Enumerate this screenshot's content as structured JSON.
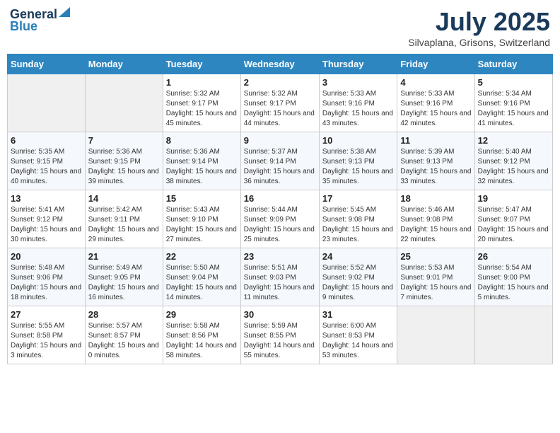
{
  "logo": {
    "general": "General",
    "blue": "Blue"
  },
  "title": "July 2025",
  "location": "Silvaplana, Grisons, Switzerland",
  "headers": [
    "Sunday",
    "Monday",
    "Tuesday",
    "Wednesday",
    "Thursday",
    "Friday",
    "Saturday"
  ],
  "weeks": [
    [
      {
        "day": "",
        "sunrise": "",
        "sunset": "",
        "daylight": ""
      },
      {
        "day": "",
        "sunrise": "",
        "sunset": "",
        "daylight": ""
      },
      {
        "day": "1",
        "sunrise": "Sunrise: 5:32 AM",
        "sunset": "Sunset: 9:17 PM",
        "daylight": "Daylight: 15 hours and 45 minutes."
      },
      {
        "day": "2",
        "sunrise": "Sunrise: 5:32 AM",
        "sunset": "Sunset: 9:17 PM",
        "daylight": "Daylight: 15 hours and 44 minutes."
      },
      {
        "day": "3",
        "sunrise": "Sunrise: 5:33 AM",
        "sunset": "Sunset: 9:16 PM",
        "daylight": "Daylight: 15 hours and 43 minutes."
      },
      {
        "day": "4",
        "sunrise": "Sunrise: 5:33 AM",
        "sunset": "Sunset: 9:16 PM",
        "daylight": "Daylight: 15 hours and 42 minutes."
      },
      {
        "day": "5",
        "sunrise": "Sunrise: 5:34 AM",
        "sunset": "Sunset: 9:16 PM",
        "daylight": "Daylight: 15 hours and 41 minutes."
      }
    ],
    [
      {
        "day": "6",
        "sunrise": "Sunrise: 5:35 AM",
        "sunset": "Sunset: 9:15 PM",
        "daylight": "Daylight: 15 hours and 40 minutes."
      },
      {
        "day": "7",
        "sunrise": "Sunrise: 5:36 AM",
        "sunset": "Sunset: 9:15 PM",
        "daylight": "Daylight: 15 hours and 39 minutes."
      },
      {
        "day": "8",
        "sunrise": "Sunrise: 5:36 AM",
        "sunset": "Sunset: 9:14 PM",
        "daylight": "Daylight: 15 hours and 38 minutes."
      },
      {
        "day": "9",
        "sunrise": "Sunrise: 5:37 AM",
        "sunset": "Sunset: 9:14 PM",
        "daylight": "Daylight: 15 hours and 36 minutes."
      },
      {
        "day": "10",
        "sunrise": "Sunrise: 5:38 AM",
        "sunset": "Sunset: 9:13 PM",
        "daylight": "Daylight: 15 hours and 35 minutes."
      },
      {
        "day": "11",
        "sunrise": "Sunrise: 5:39 AM",
        "sunset": "Sunset: 9:13 PM",
        "daylight": "Daylight: 15 hours and 33 minutes."
      },
      {
        "day": "12",
        "sunrise": "Sunrise: 5:40 AM",
        "sunset": "Sunset: 9:12 PM",
        "daylight": "Daylight: 15 hours and 32 minutes."
      }
    ],
    [
      {
        "day": "13",
        "sunrise": "Sunrise: 5:41 AM",
        "sunset": "Sunset: 9:12 PM",
        "daylight": "Daylight: 15 hours and 30 minutes."
      },
      {
        "day": "14",
        "sunrise": "Sunrise: 5:42 AM",
        "sunset": "Sunset: 9:11 PM",
        "daylight": "Daylight: 15 hours and 29 minutes."
      },
      {
        "day": "15",
        "sunrise": "Sunrise: 5:43 AM",
        "sunset": "Sunset: 9:10 PM",
        "daylight": "Daylight: 15 hours and 27 minutes."
      },
      {
        "day": "16",
        "sunrise": "Sunrise: 5:44 AM",
        "sunset": "Sunset: 9:09 PM",
        "daylight": "Daylight: 15 hours and 25 minutes."
      },
      {
        "day": "17",
        "sunrise": "Sunrise: 5:45 AM",
        "sunset": "Sunset: 9:08 PM",
        "daylight": "Daylight: 15 hours and 23 minutes."
      },
      {
        "day": "18",
        "sunrise": "Sunrise: 5:46 AM",
        "sunset": "Sunset: 9:08 PM",
        "daylight": "Daylight: 15 hours and 22 minutes."
      },
      {
        "day": "19",
        "sunrise": "Sunrise: 5:47 AM",
        "sunset": "Sunset: 9:07 PM",
        "daylight": "Daylight: 15 hours and 20 minutes."
      }
    ],
    [
      {
        "day": "20",
        "sunrise": "Sunrise: 5:48 AM",
        "sunset": "Sunset: 9:06 PM",
        "daylight": "Daylight: 15 hours and 18 minutes."
      },
      {
        "day": "21",
        "sunrise": "Sunrise: 5:49 AM",
        "sunset": "Sunset: 9:05 PM",
        "daylight": "Daylight: 15 hours and 16 minutes."
      },
      {
        "day": "22",
        "sunrise": "Sunrise: 5:50 AM",
        "sunset": "Sunset: 9:04 PM",
        "daylight": "Daylight: 15 hours and 14 minutes."
      },
      {
        "day": "23",
        "sunrise": "Sunrise: 5:51 AM",
        "sunset": "Sunset: 9:03 PM",
        "daylight": "Daylight: 15 hours and 11 minutes."
      },
      {
        "day": "24",
        "sunrise": "Sunrise: 5:52 AM",
        "sunset": "Sunset: 9:02 PM",
        "daylight": "Daylight: 15 hours and 9 minutes."
      },
      {
        "day": "25",
        "sunrise": "Sunrise: 5:53 AM",
        "sunset": "Sunset: 9:01 PM",
        "daylight": "Daylight: 15 hours and 7 minutes."
      },
      {
        "day": "26",
        "sunrise": "Sunrise: 5:54 AM",
        "sunset": "Sunset: 9:00 PM",
        "daylight": "Daylight: 15 hours and 5 minutes."
      }
    ],
    [
      {
        "day": "27",
        "sunrise": "Sunrise: 5:55 AM",
        "sunset": "Sunset: 8:58 PM",
        "daylight": "Daylight: 15 hours and 3 minutes."
      },
      {
        "day": "28",
        "sunrise": "Sunrise: 5:57 AM",
        "sunset": "Sunset: 8:57 PM",
        "daylight": "Daylight: 15 hours and 0 minutes."
      },
      {
        "day": "29",
        "sunrise": "Sunrise: 5:58 AM",
        "sunset": "Sunset: 8:56 PM",
        "daylight": "Daylight: 14 hours and 58 minutes."
      },
      {
        "day": "30",
        "sunrise": "Sunrise: 5:59 AM",
        "sunset": "Sunset: 8:55 PM",
        "daylight": "Daylight: 14 hours and 55 minutes."
      },
      {
        "day": "31",
        "sunrise": "Sunrise: 6:00 AM",
        "sunset": "Sunset: 8:53 PM",
        "daylight": "Daylight: 14 hours and 53 minutes."
      },
      {
        "day": "",
        "sunrise": "",
        "sunset": "",
        "daylight": ""
      },
      {
        "day": "",
        "sunrise": "",
        "sunset": "",
        "daylight": ""
      }
    ]
  ]
}
